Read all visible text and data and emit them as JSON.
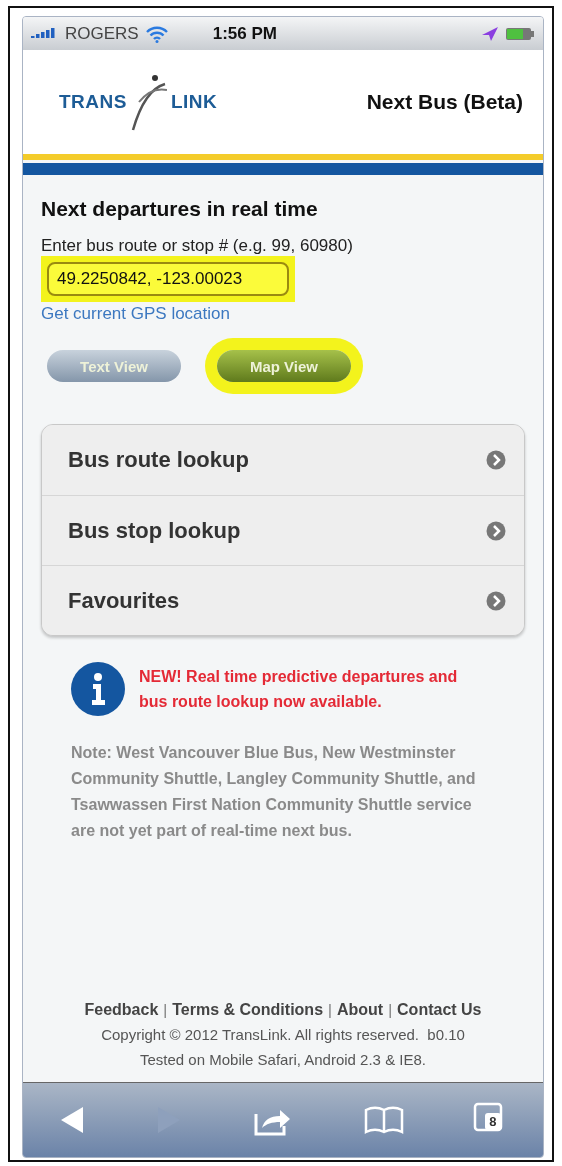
{
  "status_bar": {
    "carrier": "ROGERS",
    "time": "1:56 PM"
  },
  "header": {
    "logo": [
      "TRANS",
      "LINK"
    ],
    "title": "Next Bus (Beta)"
  },
  "main": {
    "heading": "Next departures in real time",
    "label": "Enter bus route or stop # (e.g. 99, 60980)",
    "input": {
      "value": "49.2250842, -123.00023",
      "highlighted": true
    },
    "gps_link": "Get current GPS location",
    "views": [
      {
        "label": "Text View",
        "kind": "grey",
        "highlighted": false
      },
      {
        "label": "Map View",
        "kind": "green",
        "highlighted": true
      }
    ]
  },
  "menu": [
    {
      "label": "Bus route lookup"
    },
    {
      "label": "Bus stop lookup"
    },
    {
      "label": "Favourites"
    }
  ],
  "notice": "NEW! Real time predictive departures and bus route lookup now available.",
  "note": "Note: West Vancouver Blue Bus, New Westminster Community Shuttle, Langley Community Shuttle, and Tsawwassen First Nation Community Shuttle service are not yet part of real-time next bus.",
  "footer": {
    "links": [
      "Feedback",
      "Terms & Conditions",
      "About",
      "Contact Us"
    ],
    "separator": "|",
    "copyright": "Copyright © 2012 TransLink. All rights reserved.  b0.10",
    "tested": "Tested on Mobile Safari, Android 2.3 & IE8."
  },
  "toolbar": {
    "back": {
      "disabled": false
    },
    "forward": {
      "disabled": true
    },
    "tabs_count": "8"
  }
}
